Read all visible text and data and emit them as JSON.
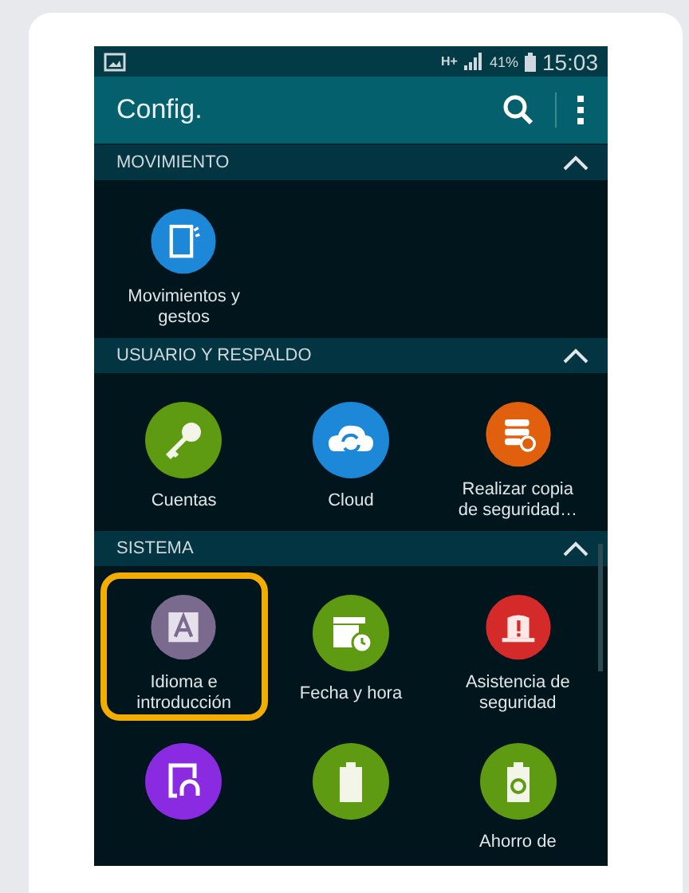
{
  "status_bar": {
    "network": "H+",
    "battery": "41%",
    "time": "15:03"
  },
  "app_bar": {
    "title": "Config."
  },
  "sections": [
    {
      "title": "MOVIMIENTO",
      "expanded": true,
      "items": [
        {
          "label": "Movimientos y gestos",
          "kind": "motion",
          "color": "#1e88d8",
          "selected": false
        }
      ]
    },
    {
      "title": "USUARIO Y RESPALDO",
      "expanded": true,
      "items": [
        {
          "label": "Cuentas",
          "kind": "key",
          "color": "#5e9a12",
          "selected": false
        },
        {
          "label": "Cloud",
          "kind": "cloud",
          "color": "#1e88d8",
          "selected": false
        },
        {
          "label": "Realizar copia de seguridad…",
          "kind": "backup",
          "color": "#e0600e",
          "selected": false
        }
      ]
    },
    {
      "title": "SISTEMA",
      "expanded": true,
      "items": [
        {
          "label": "Idioma e introducción",
          "kind": "language",
          "color": "#7a6a8e",
          "selected": true
        },
        {
          "label": "Fecha y hora",
          "kind": "calendar",
          "color": "#5e9a12",
          "selected": false
        },
        {
          "label": "Asistencia de seguridad",
          "kind": "alert",
          "color": "#d42a2a",
          "selected": false
        },
        {
          "kind": "accessibility",
          "color": "#8a2be2",
          "selected": false
        },
        {
          "kind": "battery",
          "color": "#5e9a12",
          "selected": false
        },
        {
          "label": "Ahorro de",
          "kind": "recycle",
          "color": "#5e9a12",
          "selected": false
        }
      ]
    }
  ]
}
